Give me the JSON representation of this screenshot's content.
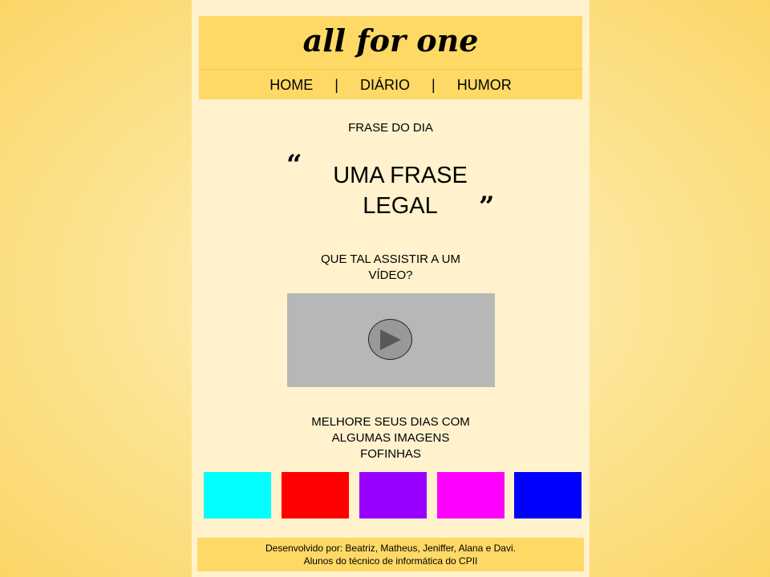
{
  "header": {
    "logo": "all for one",
    "nav": [
      {
        "label": "HOME"
      },
      {
        "label": "DIÁRIO"
      },
      {
        "label": "HUMOR"
      }
    ],
    "separator": "|"
  },
  "quote": {
    "label": "FRASE DO DIA",
    "open_mark": "“",
    "close_mark": "”",
    "line1": "UMA FRASE",
    "line2": "LEGAL"
  },
  "video": {
    "prompt_line1": "QUE TAL ASSISTIR A UM",
    "prompt_line2": "VÍDEO?",
    "icon": "play-icon"
  },
  "gallery": {
    "prompt_line1": "MELHORE SEUS DIAS COM",
    "prompt_line2": "ALGUMAS IMAGENS",
    "prompt_line3": "FOFINHAS",
    "colors": [
      "#00ffff",
      "#ff0000",
      "#9900ff",
      "#ff00ff",
      "#0000ff"
    ]
  },
  "footer": {
    "line1": "Desenvolvido por: Beatriz, Matheus, Jeniffer, Alana e Davi.",
    "line2": "Alunos do técnico de informática do CPII"
  }
}
